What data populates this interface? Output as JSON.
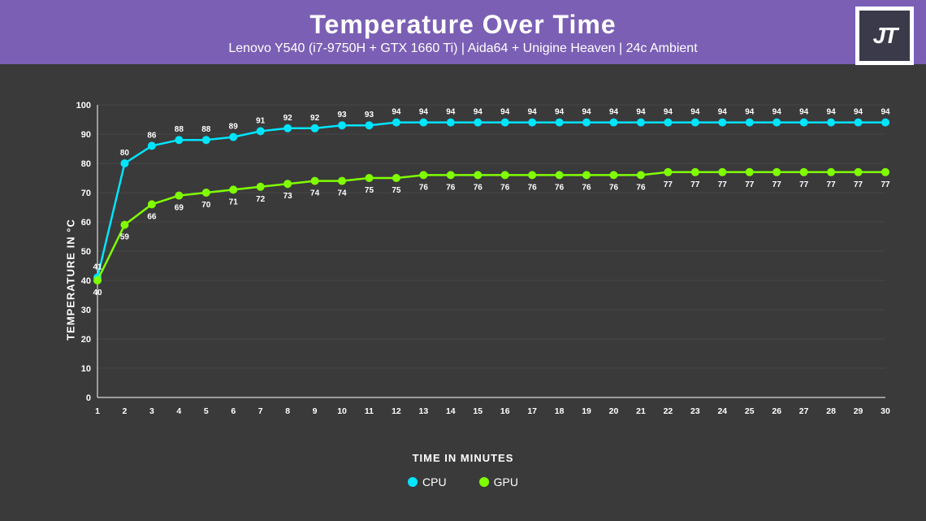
{
  "header": {
    "title": "Temperature Over Time",
    "subtitle": "Lenovo Y540 (i7-9750H + GTX 1660 Ti) | Aida64 + Unigine Heaven | 24c Ambient"
  },
  "logo": {
    "text": "JT"
  },
  "chart": {
    "y_axis_label": "TEMPERATURE IN °C",
    "x_axis_label": "TIME IN MINUTES",
    "y_ticks": [
      0,
      10,
      20,
      30,
      40,
      50,
      60,
      70,
      80,
      90,
      100
    ],
    "x_ticks": [
      1,
      2,
      3,
      4,
      5,
      6,
      7,
      8,
      9,
      10,
      11,
      12,
      13,
      14,
      15,
      16,
      17,
      18,
      19,
      20,
      21,
      22,
      23,
      24,
      25,
      26,
      27,
      28,
      29,
      30
    ],
    "cpu_data": [
      41,
      80,
      86,
      88,
      88,
      89,
      91,
      92,
      92,
      93,
      93,
      94,
      94,
      94,
      94,
      94,
      94,
      94,
      94,
      94,
      94,
      94,
      94,
      94,
      94,
      94,
      94,
      94,
      94,
      94
    ],
    "gpu_data": [
      40,
      59,
      66,
      69,
      70,
      71,
      72,
      73,
      74,
      74,
      75,
      75,
      76,
      76,
      76,
      76,
      76,
      76,
      76,
      76,
      76,
      77,
      77,
      77,
      77,
      77,
      77,
      77,
      77,
      77
    ],
    "cpu_color": "#00e5ff",
    "gpu_color": "#7fff00",
    "colors": {
      "cpu": "#00e5ff",
      "gpu": "#7fff00"
    }
  },
  "legend": {
    "cpu_label": "CPU",
    "gpu_label": "GPU"
  }
}
